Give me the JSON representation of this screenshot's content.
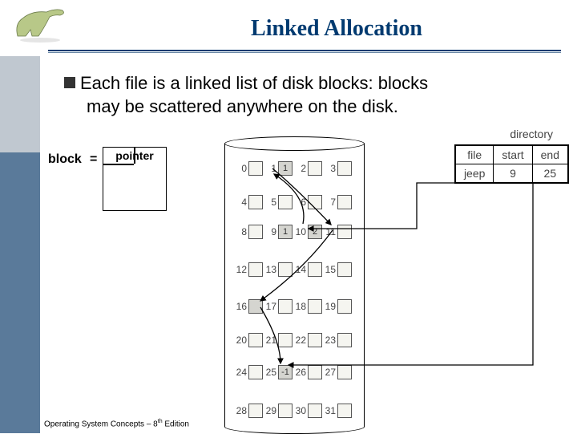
{
  "title": "Linked Allocation",
  "bullet": {
    "line1_a": "Each file is a linked list of disk blocks: blocks",
    "line1_b": "may be scattered anywhere on the disk."
  },
  "block_diagram": {
    "label_left": "block",
    "eq": "=",
    "pointer_label": "pointer"
  },
  "footer": {
    "text_a": "Operating System Concepts – 8",
    "text_b": "th",
    "text_c": " Edition"
  },
  "directory": {
    "label": "directory",
    "headers": [
      "file",
      "start",
      "end"
    ],
    "row": [
      "jeep",
      "9",
      "25"
    ]
  },
  "disk": {
    "rows": [
      {
        "labels": [
          "0",
          "1",
          "2",
          "3"
        ],
        "values": [
          "",
          "1",
          "",
          ""
        ],
        "filled": [
          false,
          true,
          false,
          false
        ]
      },
      {
        "labels": [
          "4",
          "5",
          "6",
          "7"
        ],
        "values": [
          "",
          "",
          "",
          ""
        ],
        "filled": [
          false,
          false,
          false,
          false
        ]
      },
      {
        "labels": [
          "8",
          "9",
          "10",
          "11"
        ],
        "values": [
          "",
          "1",
          "2",
          ""
        ],
        "filled": [
          false,
          true,
          true,
          false
        ]
      },
      {
        "labels": [
          "12",
          "13",
          "14",
          "15"
        ],
        "values": [
          "",
          "",
          "",
          ""
        ],
        "filled": [
          false,
          false,
          false,
          false
        ]
      },
      {
        "labels": [
          "16",
          "17",
          "18",
          "19"
        ],
        "values": [
          "",
          "",
          "",
          ""
        ],
        "filled": [
          true,
          false,
          false,
          false
        ]
      },
      {
        "labels": [
          "20",
          "21",
          "22",
          "23"
        ],
        "values": [
          "",
          "",
          "",
          ""
        ],
        "filled": [
          false,
          false,
          false,
          false
        ]
      },
      {
        "labels": [
          "24",
          "25",
          "26",
          "27"
        ],
        "values": [
          "",
          "-1",
          "",
          ""
        ],
        "filled": [
          false,
          true,
          false,
          false
        ]
      },
      {
        "labels": [
          "28",
          "29",
          "30",
          "31"
        ],
        "values": [
          "",
          "",
          "",
          ""
        ],
        "filled": [
          false,
          false,
          false,
          false
        ]
      }
    ]
  }
}
